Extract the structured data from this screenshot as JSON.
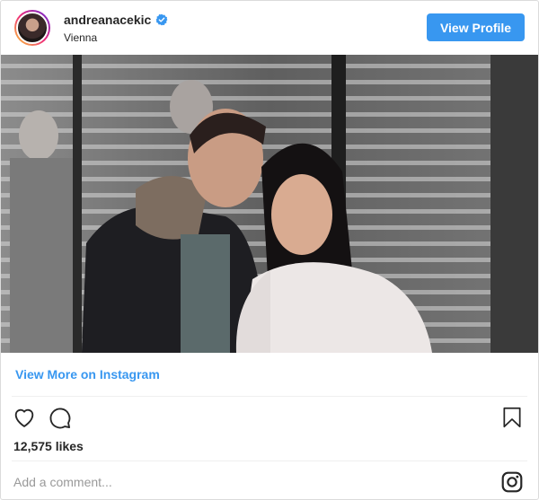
{
  "header": {
    "username": "andreanacekic",
    "location": "Vienna",
    "view_profile_label": "View Profile"
  },
  "post": {
    "view_more_label": "View More on Instagram",
    "likes_text": "12,575 likes",
    "comment_placeholder": "Add a comment..."
  },
  "icons": {
    "verified": "verified-badge-icon",
    "like": "heart-icon",
    "comment": "speech-bubble-icon",
    "save": "bookmark-icon",
    "brand": "instagram-logo-icon"
  },
  "colors": {
    "accent": "#3897f0",
    "text": "#262626",
    "placeholder": "#999999",
    "divider": "#efefef"
  }
}
